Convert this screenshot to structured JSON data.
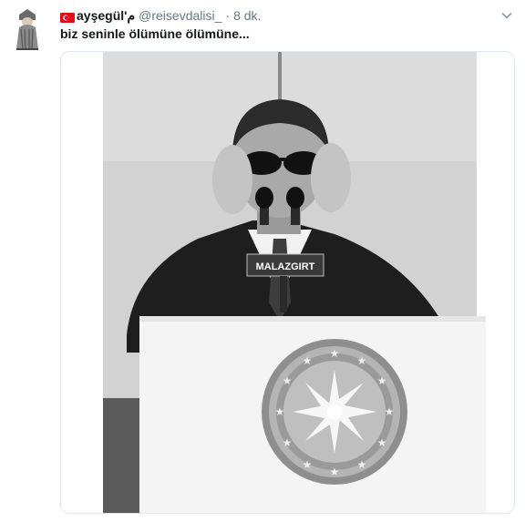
{
  "tweet": {
    "display_name": "ayşegül'م",
    "handle": "@reisevdalisi_",
    "separator": "·",
    "time": "8 dk.",
    "text": "biz seninle ölümüne ölümüne...",
    "media": {
      "lectern_sign": "MALAZGIRT"
    }
  },
  "icons": {
    "flag": "turkey-flag-icon",
    "caret": "chevron-down-icon",
    "avatar": "avatar"
  },
  "colors": {
    "flag_red": "#e30a17",
    "handle_gray": "#657786",
    "border": "#e1e8ed"
  }
}
